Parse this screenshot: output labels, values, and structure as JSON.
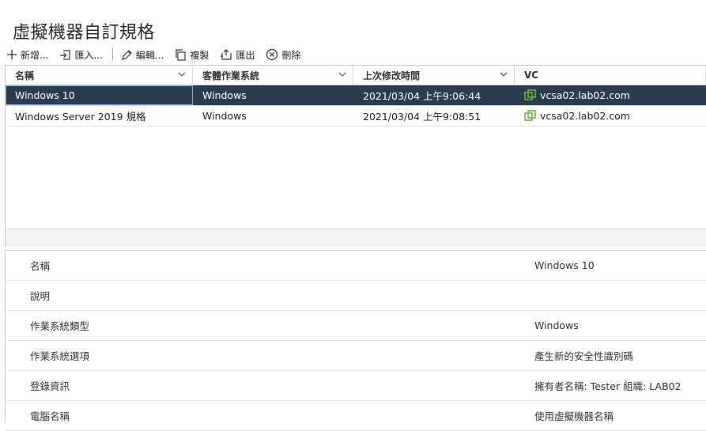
{
  "page_title": "虛擬機器自訂規格",
  "toolbar": {
    "new_label": "新增...",
    "import_label": "匯入...",
    "edit_label": "編輯...",
    "copy_label": "複製",
    "export_label": "匯出",
    "delete_label": "刪除"
  },
  "table": {
    "headers": [
      "名稱",
      "客體作業系統",
      "上次修改時間",
      "VC"
    ],
    "rows": [
      {
        "name": "Windows 10",
        "os": "Windows",
        "modified": "2021/03/04 上午9:06:44",
        "vc": "vcsa02.lab02.com"
      },
      {
        "name": "Windows Server 2019 規格",
        "os": "Windows",
        "modified": "2021/03/04 上午9:08:51",
        "vc": "vcsa02.lab02.com"
      }
    ]
  },
  "details": [
    {
      "label": "名稱",
      "value": "Windows 10"
    },
    {
      "label": "說明",
      "value": ""
    },
    {
      "label": "作業系統類型",
      "value": "Windows"
    },
    {
      "label": "作業系統選項",
      "value": "產生新的安全性識別碼"
    },
    {
      "label": "登錄資訊",
      "value": "擁有者名稱: Tester 組織: LAB02"
    },
    {
      "label": "電腦名稱",
      "value": "使用虛擬機器名稱"
    }
  ],
  "colors": {
    "selected_row": "#2a3d4f",
    "vc_icon": "#6db33f"
  }
}
